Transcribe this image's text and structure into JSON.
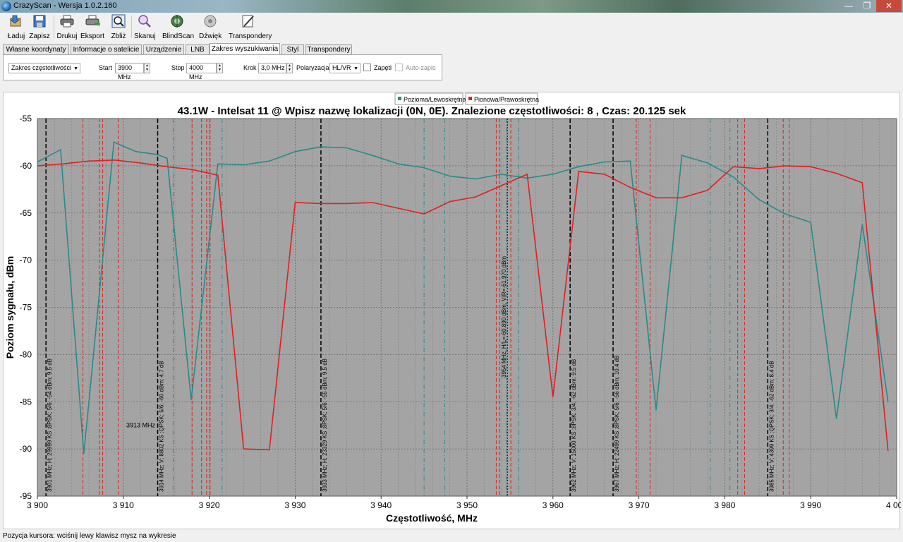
{
  "window": {
    "title": "CrazyScan - Wersja 1.0.2.160",
    "min_glyph": "—",
    "max_glyph": "❐",
    "close_glyph": "✕"
  },
  "toolbar": {
    "buttons": [
      {
        "label": "Ładuj",
        "icon": "load-icon"
      },
      {
        "label": "Zapisz",
        "icon": "save-icon"
      },
      {
        "label": "Drukuj",
        "icon": "print-icon"
      },
      {
        "label": "Eksport",
        "icon": "export-icon"
      },
      {
        "label": "Zbliż",
        "icon": "zoom-icon"
      },
      {
        "label": "Skanuj",
        "icon": "scan-icon"
      },
      {
        "label": "BlindScan",
        "icon": "blindscan-icon"
      },
      {
        "label": "Dźwięk",
        "icon": "sound-icon"
      },
      {
        "label": "Transpondery",
        "icon": "transponders-icon"
      }
    ]
  },
  "tabs": [
    "Własne koordynaty",
    "Informacje o satelicie",
    "Urządzenie",
    "LNB",
    "Zakres wyszukiwania",
    "Styl",
    "Transpondery"
  ],
  "active_tab": 4,
  "panel": {
    "range_mode": "Zakres częstotliwości",
    "start_label": "Start",
    "start_value": "3900 MHz",
    "stop_label": "Stop",
    "stop_value": "4000 MHz",
    "step_label": "Krok",
    "step_value": "3,0 MHz",
    "polarization_label": "Polaryzacja",
    "polarization_value": "HL/VR",
    "loop_label": "Zapętl",
    "autosave_label": "Auto-zapis"
  },
  "colors": {
    "horizontal": "#2a8a8a",
    "vertical": "#e02020",
    "plot_bg": "#a4a4a4"
  },
  "chart_data": {
    "type": "line",
    "title": "43.1W - Intelsat 11 @ Wpisz nazwę lokalizacji (0N, 0E). Znalezione częstotliwości: 8 , Czas: 20.125 sek",
    "xlabel": "Częstotliwość, MHz",
    "ylabel": "Poziom sygnału, dBm",
    "xlim": [
      3900,
      4000
    ],
    "ylim": [
      -95,
      -55
    ],
    "xticks": [
      3900,
      3910,
      3920,
      3930,
      3940,
      3950,
      3960,
      3970,
      3980,
      3990,
      4000
    ],
    "xtick_labels": [
      "3 900",
      "3 910",
      "3 920",
      "3 930",
      "3 940",
      "3 950",
      "3 960",
      "3 970",
      "3 980",
      "3 990",
      "4 000"
    ],
    "yticks": [
      -55,
      -60,
      -65,
      -70,
      -75,
      -80,
      -85,
      -90,
      -95
    ],
    "ytick_labels": [
      "-55",
      "-60",
      "-65",
      "-70",
      "-75",
      "-80",
      "-85",
      "-90",
      "-95"
    ],
    "grid": true,
    "legend_position": "top-center",
    "series": [
      {
        "name": "Pozioma/Lewoskrętna",
        "color": "#2a8a8a",
        "x": [
          3900,
          3902.7,
          3905.4,
          3906.0,
          3908.9,
          3911.5,
          3913.9,
          3915.1,
          3917.9,
          3921.0,
          3924.0,
          3927.0,
          3930.0,
          3933.0,
          3936.0,
          3939.0,
          3942.0,
          3945.0,
          3948.0,
          3951.0,
          3954.0,
          3957.0,
          3960.0,
          3963.0,
          3966.0,
          3969.0,
          3972.0,
          3975.0,
          3978.0,
          3981.0,
          3984.0,
          3987.0,
          3990.0,
          3993.0,
          3996.0,
          3999.0
        ],
        "y": [
          -59.6,
          -58.3,
          -90.5,
          -85.0,
          -57.5,
          -58.5,
          -58.8,
          -59.2,
          -84.8,
          -59.8,
          -59.9,
          -59.5,
          -58.5,
          -58.0,
          -58.1,
          -58.9,
          -59.8,
          -60.2,
          -61.1,
          -61.4,
          -60.9,
          -61.3,
          -60.9,
          -60.1,
          -59.6,
          -59.5,
          -85.9,
          -58.9,
          -59.7,
          -61.2,
          -63.6,
          -65.1,
          -66.0,
          -86.8,
          -66.2,
          -85.0
        ]
      },
      {
        "name": "Pionowa/Prawoskrętna",
        "color": "#e02020",
        "x": [
          3900,
          3903.0,
          3906.0,
          3909.0,
          3912.0,
          3915.0,
          3918.0,
          3921.0,
          3924.0,
          3927.0,
          3930.0,
          3933.0,
          3936.0,
          3939.0,
          3942.0,
          3945.0,
          3948.0,
          3951.0,
          3954.0,
          3957.0,
          3960.0,
          3963.0,
          3966.0,
          3969.0,
          3972.0,
          3975.0,
          3978.0,
          3981.0,
          3984.0,
          3987.0,
          3990.0,
          3993.0,
          3996.0,
          3999.0
        ],
        "y": [
          -60.0,
          -59.8,
          -59.5,
          -59.4,
          -59.7,
          -60.1,
          -60.4,
          -61.0,
          -90.0,
          -90.1,
          -63.9,
          -64.0,
          -64.0,
          -63.9,
          -64.5,
          -65.1,
          -63.8,
          -63.3,
          -62.1,
          -60.9,
          -84.5,
          -60.6,
          -60.9,
          -62.3,
          -63.4,
          -63.4,
          -62.6,
          -60.1,
          -60.3,
          -60.0,
          -60.1,
          -60.8,
          -61.8,
          -90.2
        ]
      }
    ],
    "markers_black": [
      {
        "freq": 3901,
        "label": "3901 MHz; H; 29999 KS ;8PSK; 5/6; -54 dBm; 9.5 dB"
      },
      {
        "freq": 3914,
        "label": "3914 MHz; V; 8802 KS ;QPSK; 5/6; -60 dBm; 4.7 dB"
      },
      {
        "freq": 3933,
        "label": "3933 MHz; H; 23329 KS ;8PSK; 5/6; -55 dBm; 9.5 dB"
      },
      {
        "freq": 3962,
        "label": "3962 MHz; V; 15000 KS ;8PSK; 3/4; -62 dBm; 9.5 dB"
      },
      {
        "freq": 3967,
        "label": "3967 MHz; H; 22499 KS ;8PSK; 5/6; -56 dBm; 10.4 dB"
      },
      {
        "freq": 3985,
        "label": "3985 MHz; V; 4399 KS ;QPSK; 3/4; -62 dBm; 8.4 dB"
      }
    ],
    "markers_red": [
      3905.3,
      3907.2,
      3907.6,
      3909.4,
      3918.0,
      3919.1,
      3919.7,
      3920.1,
      3953.4,
      3953.8,
      3955.1,
      3969.7,
      3971.3,
      3981.5,
      3982.3,
      3986.8,
      3987.5
    ],
    "markers_teal": [
      3915.8,
      3921.5,
      3945.0,
      3947.4,
      3954.6,
      3956.0,
      3978.3,
      3980.6
    ],
    "cursor_marker": {
      "freq": 3954.7,
      "label": "3954 MHz; H/L=-60.890 dBm; V/R=-61.970 dBm"
    },
    "annotation": {
      "freq": 3911,
      "level": -87.7,
      "text": "3913 MHz"
    }
  },
  "status": "Pozycja kursora: wciśnij lewy klawisz mysz na wykresie"
}
